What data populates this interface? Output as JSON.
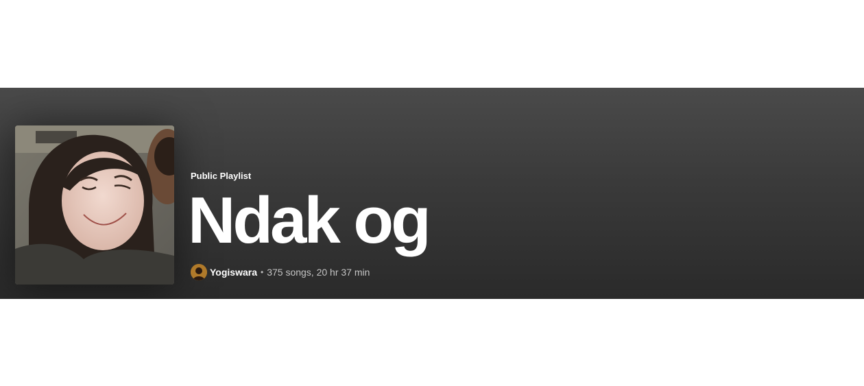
{
  "playlist": {
    "type_label": "Public Playlist",
    "title": "Ndak og",
    "owner": "Yogiswara",
    "separator": "•",
    "stats": "375 songs, 20 hr 37 min"
  },
  "colors": {
    "header_top": "#4a4a4a",
    "header_bottom": "#2a2a2a",
    "text_primary": "#ffffff",
    "text_secondary": "#c4c4c4"
  },
  "icons": {
    "cover": "playlist-cover-image",
    "avatar": "user-avatar-image"
  }
}
